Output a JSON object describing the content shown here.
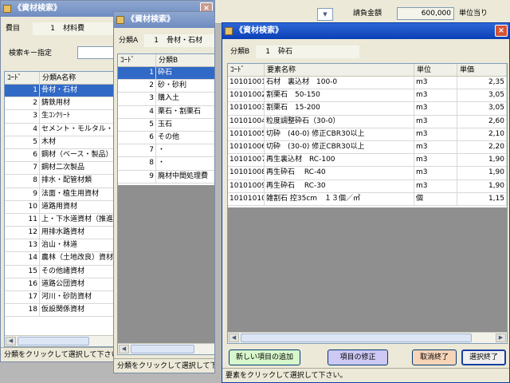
{
  "main": {
    "dropdown_arrow": "▼",
    "contract_amount_label": "請負金額",
    "contract_amount_value": "600,000",
    "unit_price_label": "単位当り"
  },
  "window1": {
    "title": "《資材検索》",
    "expense_label": "費目",
    "expense_code": "1",
    "expense_name": "材料費",
    "search_key_label": "検索キー指定",
    "columns": [
      "ｺｰﾄﾞ",
      "分類A名称"
    ],
    "rows": [
      {
        "code": "1",
        "name": "骨材・石材"
      },
      {
        "code": "2",
        "name": "鋳鉄用材"
      },
      {
        "code": "3",
        "name": "生ｺﾝｸﾘｰﾄ"
      },
      {
        "code": "4",
        "name": "セメント・モルタル・"
      },
      {
        "code": "5",
        "name": "木材"
      },
      {
        "code": "6",
        "name": "鋼材（ベース・製品）"
      },
      {
        "code": "7",
        "name": "鋼材二次製品"
      },
      {
        "code": "8",
        "name": "排水・配管材類"
      },
      {
        "code": "9",
        "name": "法面・植生用資材"
      },
      {
        "code": "10",
        "name": "道路用資材"
      },
      {
        "code": "11",
        "name": "上・下水道資材（推進"
      },
      {
        "code": "12",
        "name": "用排水路資材"
      },
      {
        "code": "13",
        "name": "治山・林道"
      },
      {
        "code": "14",
        "name": "農林（土地改良）資材"
      },
      {
        "code": "15",
        "name": "その他諸資材"
      },
      {
        "code": "16",
        "name": "道路公団資材"
      },
      {
        "code": "17",
        "name": "河川・砂防資材"
      },
      {
        "code": "18",
        "name": "仮設関係資材"
      }
    ],
    "status": "分類をクリックして選択して下さい"
  },
  "window2": {
    "title": "《資材検索》",
    "class_a_label": "分類A",
    "class_a_code": "1",
    "class_a_name": "骨材・石材",
    "columns": [
      "ｺｰﾄﾞ",
      "分類B"
    ],
    "rows": [
      {
        "code": "1",
        "name": "砕石"
      },
      {
        "code": "2",
        "name": "砂・砂利"
      },
      {
        "code": "3",
        "name": "購入土"
      },
      {
        "code": "4",
        "name": "栗石・割栗石"
      },
      {
        "code": "5",
        "name": "玉石"
      },
      {
        "code": "6",
        "name": "その他"
      },
      {
        "code": "7",
        "name": "・"
      },
      {
        "code": "8",
        "name": "・"
      },
      {
        "code": "9",
        "name": "廃材中間処理費"
      }
    ],
    "status": "分類をクリックして選択して下さい。"
  },
  "window3": {
    "title": "《資材検索》",
    "class_b_label": "分類B",
    "class_b_code": "1",
    "class_b_name": "砕石",
    "columns": [
      "ｺｰﾄﾞ",
      "要素名称",
      "単位",
      "単価"
    ],
    "rows": [
      {
        "code": "10101001",
        "name": "石材　裏込材　100-0",
        "unit": "m3",
        "price": "2,35"
      },
      {
        "code": "10101002",
        "name": "割栗石　50-150",
        "unit": "m3",
        "price": "3,05"
      },
      {
        "code": "10101003",
        "name": "割栗石　15-200",
        "unit": "m3",
        "price": "3,05"
      },
      {
        "code": "10101004",
        "name": "粒度調整砕石（30-0）",
        "unit": "m3",
        "price": "2,60"
      },
      {
        "code": "10101005",
        "name": "切砕　(40-0) 修正CBR30以上",
        "unit": "m3",
        "price": "2,10"
      },
      {
        "code": "10101006",
        "name": "切砕　(30-0) 修正CBR30以上",
        "unit": "m3",
        "price": "2,20"
      },
      {
        "code": "10101007",
        "name": "再生裏込材　RC-100",
        "unit": "m3",
        "price": "1,90"
      },
      {
        "code": "10101008",
        "name": "再生砕石　 RC-40",
        "unit": "m3",
        "price": "1,90"
      },
      {
        "code": "10101009",
        "name": "再生砕石　 RC-30",
        "unit": "m3",
        "price": "1,90"
      },
      {
        "code": "10101010",
        "name": "雑割石 控35cm　１３個／㎡",
        "unit": "個",
        "price": "1,15"
      }
    ],
    "buttons": {
      "add_new": "新しい項目の追加",
      "modify": "項目の修正",
      "cancel": "取消終了",
      "select": "選択終了"
    },
    "status": "要素をクリックして選択して下さい。"
  }
}
